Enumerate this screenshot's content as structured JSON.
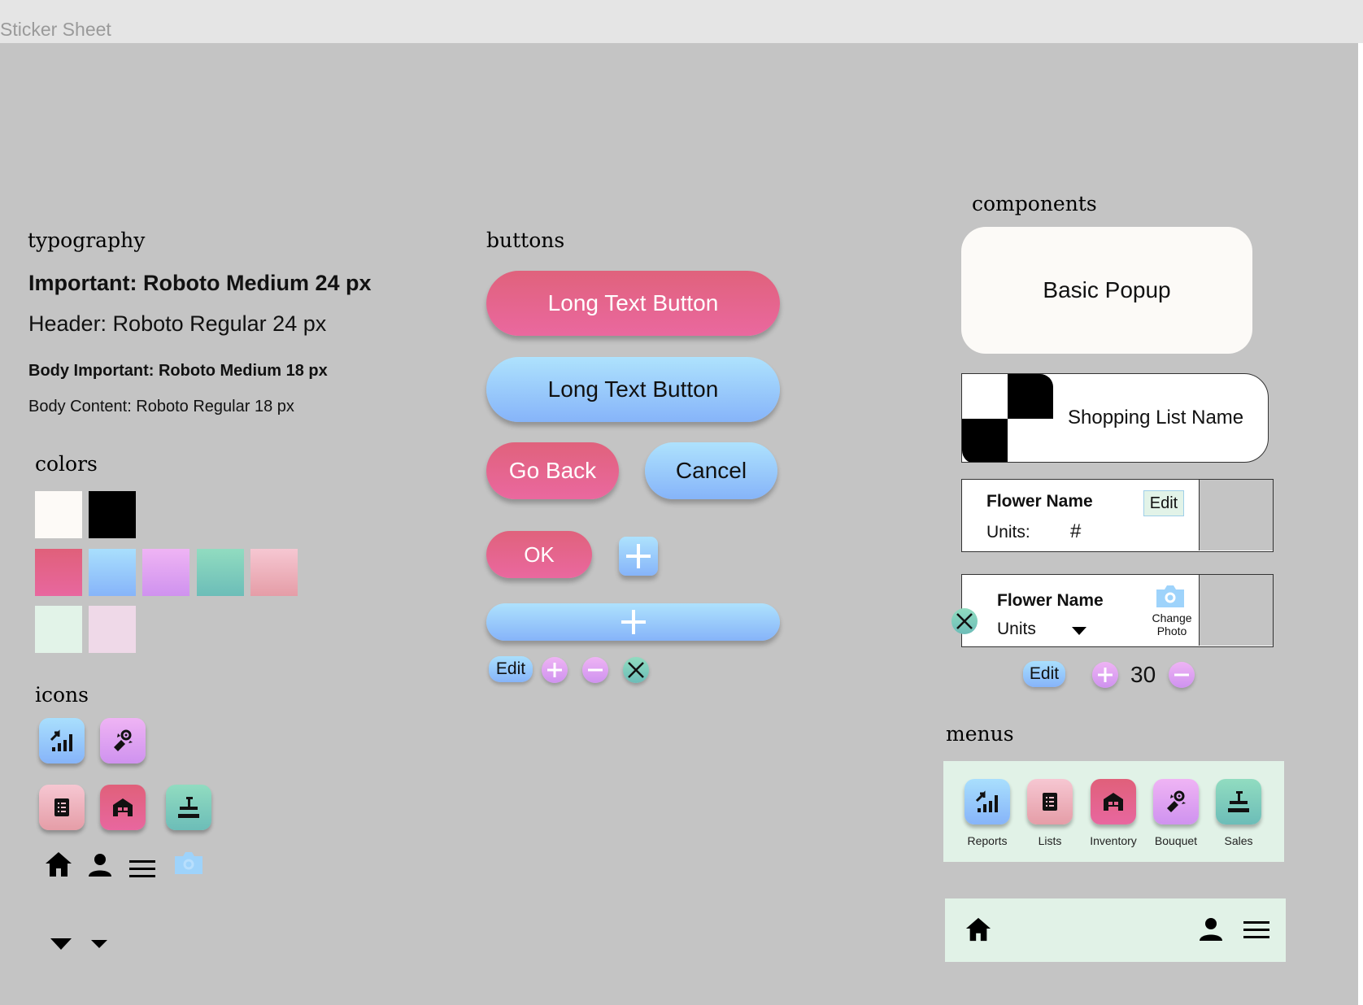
{
  "window": {
    "title": "Sticker Sheet"
  },
  "sections": {
    "typography": "typography",
    "buttons": "buttons",
    "components": "components",
    "colors": "colors",
    "icons": "icons",
    "menus": "menus"
  },
  "typography": {
    "important": "Important: Roboto Medium 24 px",
    "header": "Header: Roboto Regular 24 px",
    "body_important": "Body Important: Roboto Medium 18 px",
    "body_content": "Body Content: Roboto Regular 18 px"
  },
  "colors": {
    "white": "#fdfaf7",
    "black": "#000000",
    "pink_gradient": [
      "#e0607a",
      "#e8679f"
    ],
    "blue_gradient": [
      "#a9dffd",
      "#86b4f9"
    ],
    "purple_gradient": [
      "#efb4f4",
      "#cf92ef"
    ],
    "teal_gradient": [
      "#91dcc0",
      "#6cbdb8"
    ],
    "rose_gradient": [
      "#f6c7d2",
      "#e59da7"
    ],
    "mint": "#e2f3e8",
    "lilac": "#efd9e8",
    "canvas_gray": "#c4c4c4"
  },
  "buttons": {
    "long_pink": "Long Text Button",
    "long_blue": "Long Text Button",
    "go_back": "Go Back",
    "cancel": "Cancel",
    "ok": "OK",
    "edit": "Edit"
  },
  "components": {
    "popup": "Basic Popup",
    "shopping_list_name": "Shopping List Name",
    "card1": {
      "name": "Flower Name",
      "edit": "Edit",
      "units_label": "Units:",
      "units_value": "#"
    },
    "card2": {
      "name": "Flower Name",
      "units": "Units",
      "change_photo": "Change\nPhoto"
    },
    "stepper": {
      "edit": "Edit",
      "value": "30"
    }
  },
  "menus": {
    "items": [
      {
        "label": "Reports",
        "icon": "reports-icon"
      },
      {
        "label": "Lists",
        "icon": "lists-icon"
      },
      {
        "label": "Inventory",
        "icon": "inventory-icon"
      },
      {
        "label": "Bouquet",
        "icon": "bouquet-icon"
      },
      {
        "label": "Sales",
        "icon": "sales-icon"
      }
    ],
    "bottom_nav": [
      "home-icon",
      "person-icon",
      "hamburger-menu-icon"
    ]
  }
}
